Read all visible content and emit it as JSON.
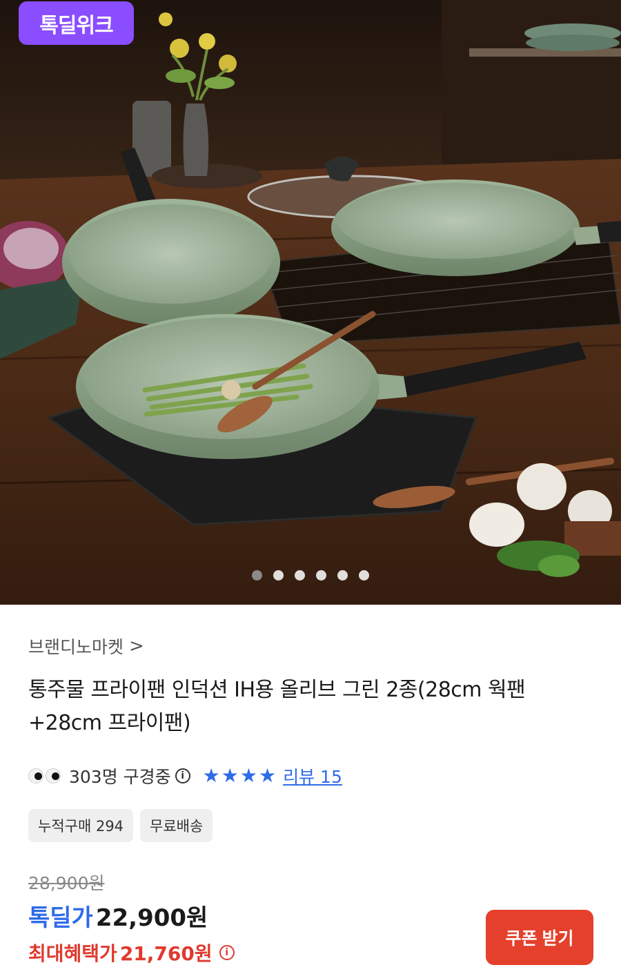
{
  "hero": {
    "badge": "톡딜위크",
    "carousel_dots": 6,
    "active_dot": 0
  },
  "seller": {
    "name": "브랜디노마켓",
    "chevron": ">"
  },
  "product": {
    "title": "통주물 프라이팬 인덕션 IH용 올리브 그린 2종(28cm 웍팬+28cm 프라이팬)"
  },
  "stats": {
    "viewers": "303명 구경중",
    "info_icon": "i",
    "rating_stars": 4,
    "review_label": "리뷰 15"
  },
  "tags": [
    "누적구매 294",
    "무료배송"
  ],
  "price": {
    "original": "28,900원",
    "deal_label": "톡딜가",
    "deal_price": "22,900원",
    "max_label": "최대혜택가",
    "max_price": "21,760원"
  },
  "coupon_button": "쿠폰 받기",
  "colors": {
    "badge": "#8a4dff",
    "accent_blue": "#2f6be8",
    "accent_red": "#e03a2f",
    "button_red": "#e5402b"
  }
}
